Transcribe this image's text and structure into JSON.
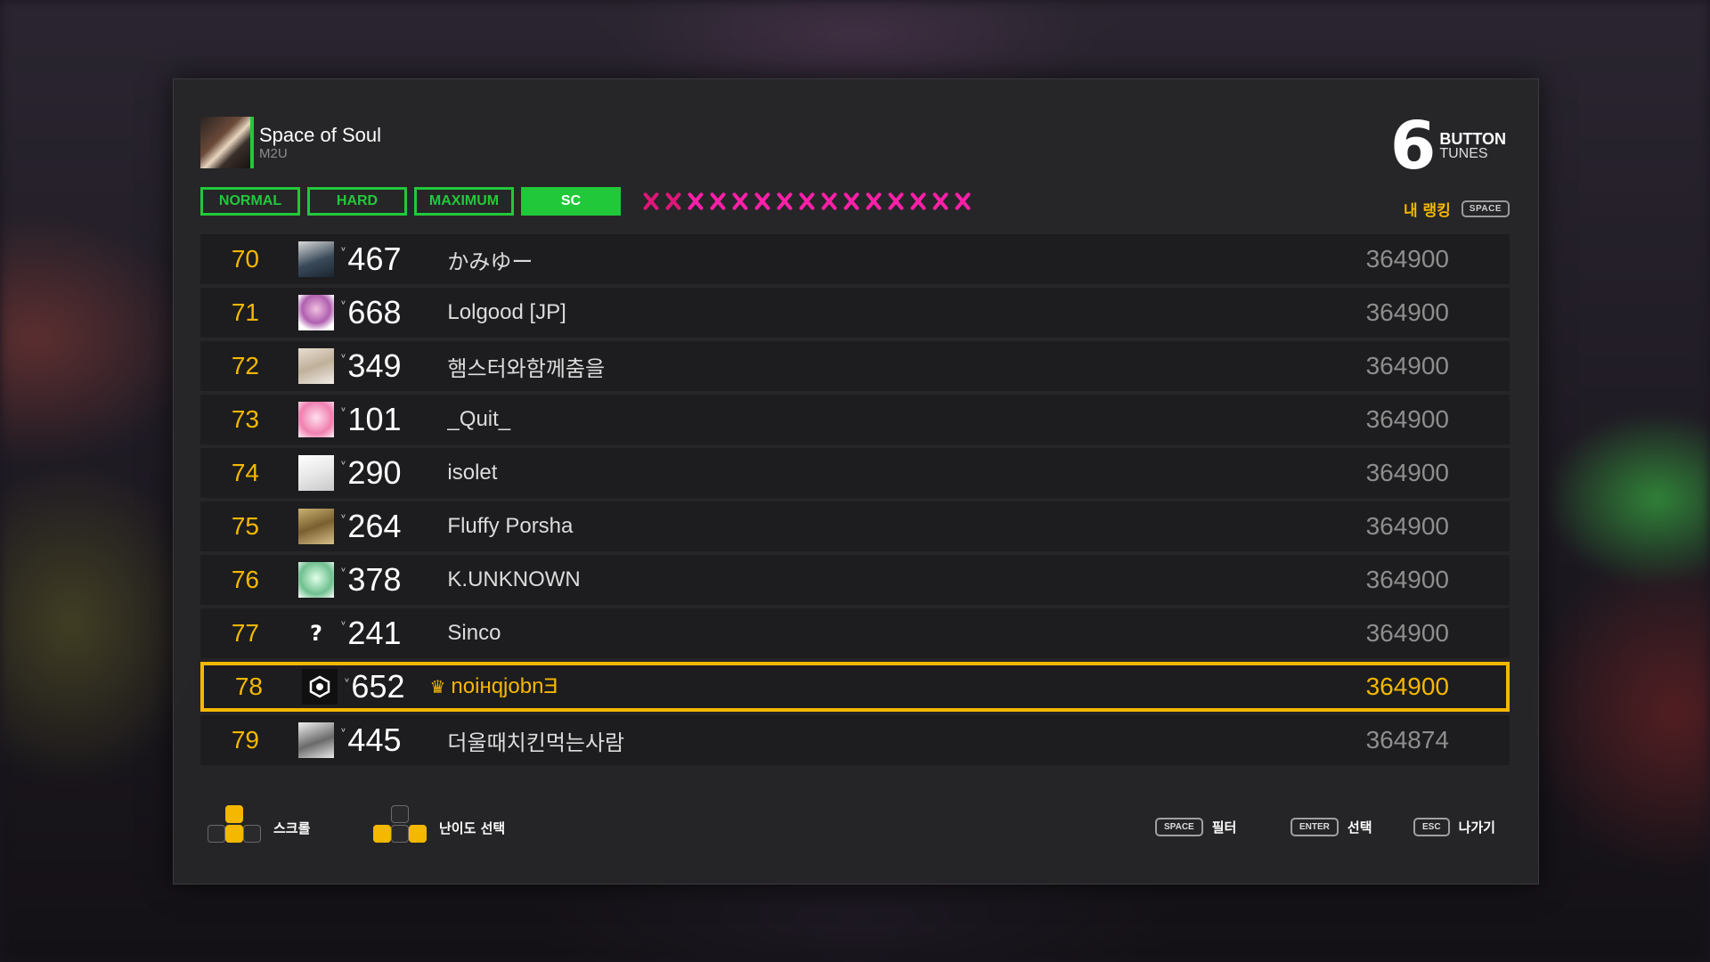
{
  "song": {
    "title": "Space of Soul",
    "artist": "M2U"
  },
  "logo": {
    "number": "6",
    "word1": "BUTTON",
    "word2": "TUNES"
  },
  "difficulty_tabs": [
    "NORMAL",
    "HARD",
    "MAXIMUM",
    "SC"
  ],
  "active_tab": "SC",
  "level_marks": 15,
  "my_ranking": {
    "label": "내 랭킹",
    "key": "SPACE"
  },
  "rankings": [
    {
      "rank": "70",
      "level": "467",
      "name": "かみゆー",
      "score": "364900"
    },
    {
      "rank": "71",
      "level": "668",
      "name": "Lolgood [JP]",
      "score": "364900"
    },
    {
      "rank": "72",
      "level": "349",
      "name": "햄스터와함께춤을",
      "score": "364900"
    },
    {
      "rank": "73",
      "level": "101",
      "name": "_Quit_",
      "score": "364900"
    },
    {
      "rank": "74",
      "level": "290",
      "name": "isolet",
      "score": "364900"
    },
    {
      "rank": "75",
      "level": "264",
      "name": "Fluffy Porsha",
      "score": "364900"
    },
    {
      "rank": "76",
      "level": "378",
      "name": "K.UNKNOWN",
      "score": "364900"
    },
    {
      "rank": "77",
      "level": "241",
      "name": "Sinco",
      "score": "364900"
    },
    {
      "rank": "78",
      "level": "652",
      "name": "noiнqjobnƎ",
      "score": "364900"
    },
    {
      "rank": "79",
      "level": "445",
      "name": "더울때치킨먹는사람",
      "score": "364874"
    }
  ],
  "unknown_avatar_glyph": "?",
  "footer": {
    "scroll_label": "스크롤",
    "difficulty_label": "난이도 선택",
    "filter_key": "SPACE",
    "filter_label": "필터",
    "select_key": "ENTER",
    "select_label": "선택",
    "exit_key": "ESC",
    "exit_label": "나가기"
  },
  "colors": {
    "accent_green": "#21c93a",
    "accent_gold": "#f5b800",
    "level_mark_pink": "#ff1fa8"
  }
}
